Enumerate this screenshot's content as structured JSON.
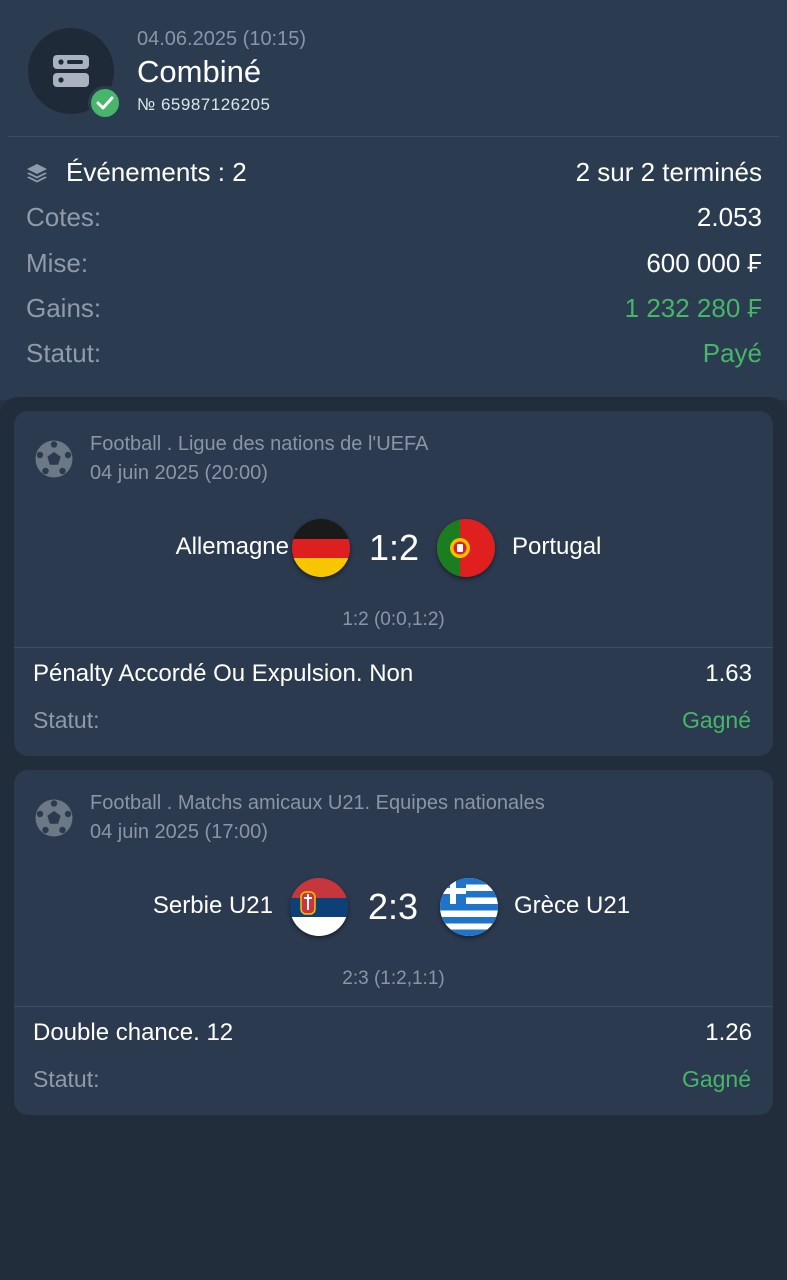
{
  "header": {
    "date": "04.06.2025 (10:15)",
    "title": "Combiné",
    "number": "№ 65987126205"
  },
  "summary": {
    "events_label": "Événements : 2",
    "events_done": "2 sur 2 terminés",
    "odds_label": "Cotes:",
    "odds_value": "2.053",
    "stake_label": "Mise:",
    "stake_value": "600 000 ₣",
    "winnings_label": "Gains:",
    "winnings_value": "1 232 280 ₣",
    "status_label": "Statut:",
    "status_value": "Payé"
  },
  "events": [
    {
      "league": "Football . Ligue des nations de l'UEFA",
      "datetime": "04 juin 2025 (20:00)",
      "home": "Allemagne",
      "away": "Portugal",
      "score": "1:2",
      "score_detail": "1:2 (0:0,1:2)",
      "bet": "Pénalty Accordé Ou Expulsion. Non",
      "odd": "1.63",
      "status_label": "Statut:",
      "status_value": "Gagné"
    },
    {
      "league": "Football . Matchs amicaux U21. Equipes nationales",
      "datetime": "04 juin 2025 (17:00)",
      "home": "Serbie U21",
      "away": "Grèce U21",
      "score": "2:3",
      "score_detail": "2:3 (1:2,1:1)",
      "bet": "Double chance. 12",
      "odd": "1.26",
      "status_label": "Statut:",
      "status_value": "Gagné"
    }
  ],
  "icons": {
    "coupon": "coupon-icon",
    "check": "check-icon",
    "layers": "layers-icon",
    "sport": "football-icon"
  },
  "colors": {
    "background": "#253244",
    "header": "#2b3b50",
    "card": "#2b3a4f",
    "green": "#47b56a",
    "muted": "#8a96a6"
  }
}
